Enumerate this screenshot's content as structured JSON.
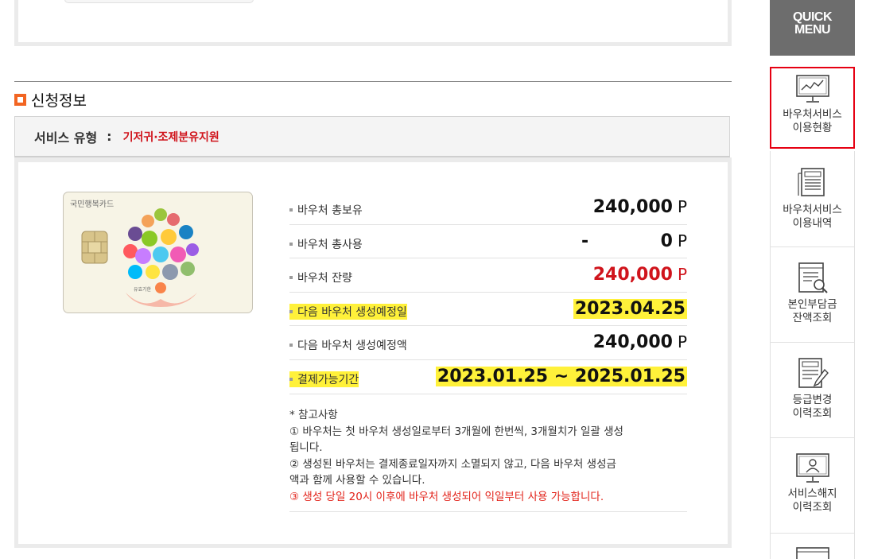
{
  "section": {
    "title": "신청정보"
  },
  "service": {
    "label": "서비스 유형",
    "colon": ":",
    "value": "기저귀·조제분유지원"
  },
  "card": {
    "brand": "국민행복카드",
    "small_text": "유효기한"
  },
  "rows": [
    {
      "label": "바우처 총보유",
      "value": "240,000",
      "unit": "P"
    },
    {
      "label": "바우처 총사용",
      "prefix": "-",
      "value": "0",
      "unit": "P"
    },
    {
      "label": "바우처 잔량",
      "value": "240,000",
      "unit": "P"
    },
    {
      "label": "다음 바우처 생성예정일",
      "value": "2023.04.25"
    },
    {
      "label": "다음 바우처 생성예정액",
      "value": "240,000",
      "unit": "P"
    },
    {
      "label": "결제가능기간",
      "value": "2023.01.25 ~ 2025.01.25"
    }
  ],
  "notes": {
    "heading": "* 참고사항",
    "note1_line1": "① 바우처는 첫 바우처 생성일로부터 3개월에 한번씩, 3개월치가 일괄 생성",
    "note1_line2": "됩니다.",
    "note2_line1": "② 생성된 바우처는 결제종료일자까지 소멸되지 않고, 다음 바우처 생성금",
    "note2_line2": "액과 함께 사용할 수 있습니다.",
    "note3": "③ 생성 당일 20시 이후에 바우처 생성되어 익일부터 사용 가능합니다."
  },
  "quick_menu": {
    "title_line1": "QUICK",
    "title_line2": "MENU",
    "items": [
      {
        "line1": "바우처서비스",
        "line2": "이용현황"
      },
      {
        "line1": "바우처서비스",
        "line2": "이용내역"
      },
      {
        "line1": "본인부담금",
        "line2": "잔액조회"
      },
      {
        "line1": "등급변경",
        "line2": "이력조회"
      },
      {
        "line1": "서비스해지",
        "line2": "이력조회"
      }
    ]
  },
  "colors": {
    "accent_red": "#d0141c",
    "highlight": "#fff13a",
    "section_bullet": "#f26522",
    "quick_header": "#6d6d6d"
  }
}
